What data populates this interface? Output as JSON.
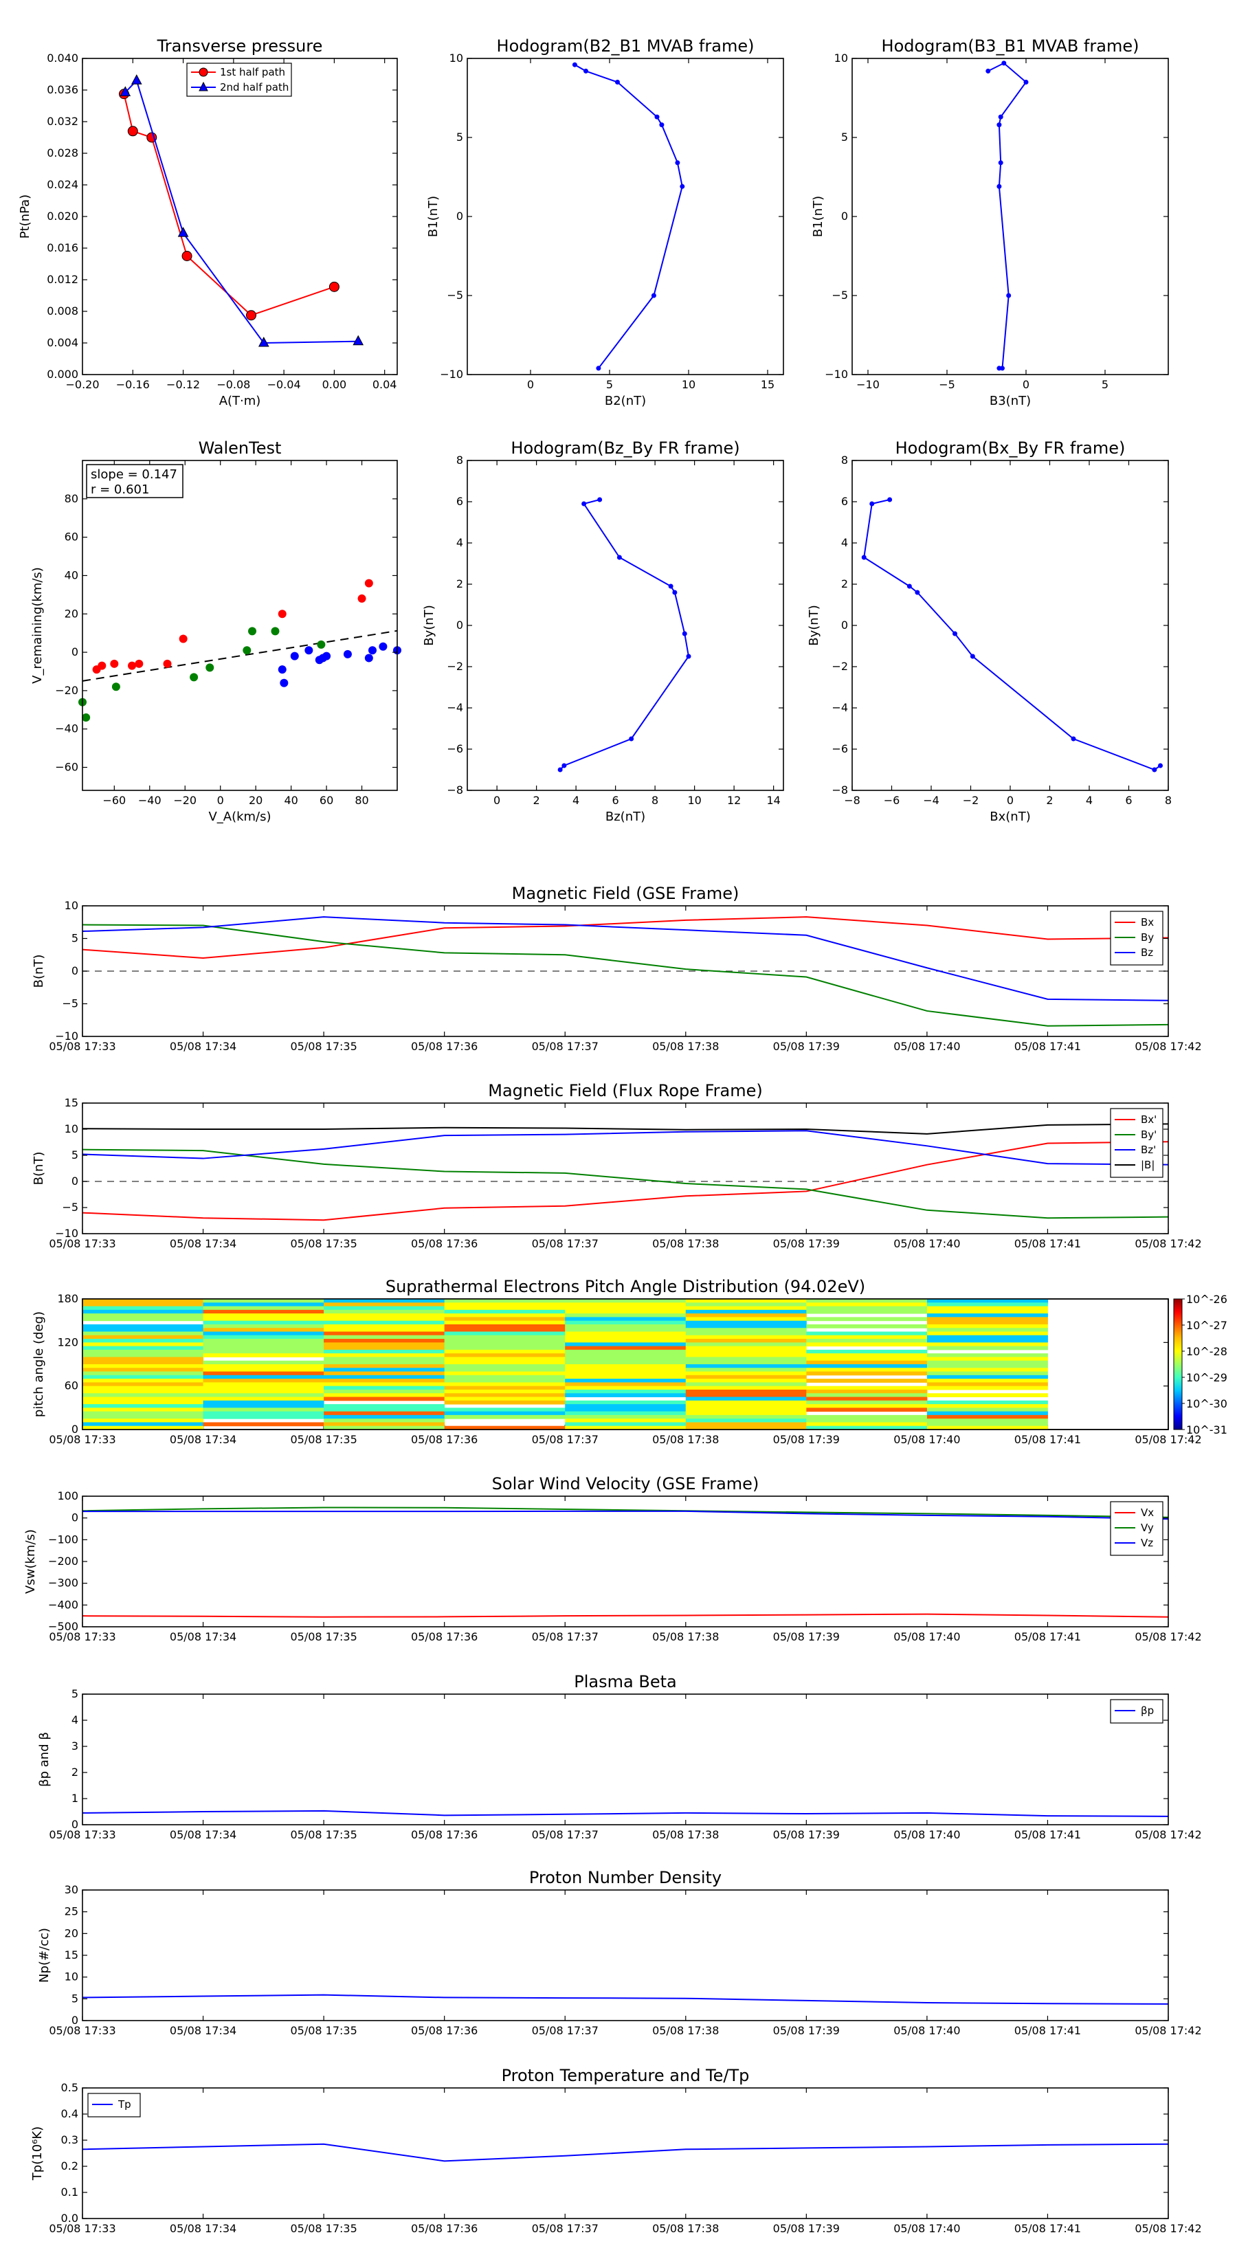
{
  "chart_data": [
    {
      "type": "line",
      "title": "Transverse pressure",
      "xlabel": "A(T·m)",
      "ylabel": "Pt(nPa)",
      "xlim": [
        -0.2,
        0.05
      ],
      "ylim": [
        0.0,
        0.04
      ],
      "xticks": [
        "−0.20",
        "−0.16",
        "−0.12",
        "−0.08",
        "−0.04",
        "0.00",
        "0.04"
      ],
      "yticks": [
        "0.000",
        "0.004",
        "0.008",
        "0.012",
        "0.016",
        "0.020",
        "0.024",
        "0.028",
        "0.032",
        "0.036",
        "0.040"
      ],
      "legend_position": "top-right",
      "series": [
        {
          "name": "1st half path",
          "color": "#ff0000",
          "marker": "circle",
          "x": [
            -0.167,
            -0.16,
            -0.145,
            -0.117,
            -0.066,
            0.0
          ],
          "y": [
            0.0355,
            0.0308,
            0.03,
            0.015,
            0.0075,
            0.0111
          ]
        },
        {
          "name": "2nd half path",
          "color": "#0000ff",
          "marker": "triangle",
          "x": [
            -0.166,
            -0.157,
            -0.12,
            -0.056,
            0.019
          ],
          "y": [
            0.0357,
            0.0372,
            0.0179,
            0.004,
            0.0042
          ]
        }
      ]
    },
    {
      "type": "line",
      "title": "Hodogram(B2_B1 MVAB frame)",
      "xlabel": "B2(nT)",
      "ylabel": "B1(nT)",
      "xlim": [
        -4,
        16
      ],
      "ylim": [
        -10,
        10
      ],
      "xticks": [
        "0",
        "5",
        "10",
        "15"
      ],
      "yticks": [
        "−10",
        "−5",
        "0",
        "5",
        "10"
      ],
      "series": [
        {
          "name": "",
          "color": "#0000ff",
          "x": [
            2.8,
            3.5,
            5.5,
            8.0,
            8.3,
            9.3,
            9.6,
            7.8,
            4.3
          ],
          "y": [
            9.6,
            9.2,
            8.5,
            6.3,
            5.8,
            3.4,
            1.9,
            -5.0,
            -9.6
          ]
        }
      ]
    },
    {
      "type": "line",
      "title": "Hodogram(B3_B1 MVAB frame)",
      "xlabel": "B3(nT)",
      "ylabel": "B1(nT)",
      "xlim": [
        -11,
        9
      ],
      "ylim": [
        -10,
        10
      ],
      "xticks": [
        "−10",
        "−5",
        "0",
        "5"
      ],
      "yticks": [
        "−10",
        "−5",
        "0",
        "5",
        "10"
      ],
      "series": [
        {
          "name": "",
          "color": "#0000ff",
          "x": [
            -2.4,
            -1.4,
            0.0,
            -1.6,
            -1.7,
            -1.6,
            -1.7,
            -1.1,
            -1.5,
            -1.7
          ],
          "y": [
            9.2,
            9.7,
            8.5,
            6.3,
            5.8,
            3.4,
            1.9,
            -5.0,
            -9.6,
            -9.6
          ]
        }
      ]
    },
    {
      "type": "scatter",
      "title": "WalenTest",
      "xlabel": "V_A(km/s)",
      "ylabel": "V_remaining(km/s)",
      "xlim": [
        -78,
        100
      ],
      "ylim": [
        -72,
        100
      ],
      "xticks": [
        "−60",
        "−40",
        "−20",
        "0",
        "20",
        "40",
        "60",
        "80"
      ],
      "yticks": [
        "−60",
        "−40",
        "−20",
        "0",
        "20",
        "40",
        "60",
        "80"
      ],
      "annotations": [
        "slope = 0.147",
        "r = 0.601"
      ],
      "fit_line": {
        "slope": 0.147,
        "intercept": -3.5,
        "style": "dashed"
      },
      "series": [
        {
          "name": "",
          "color": "#ff0000",
          "x": [
            -70,
            -67,
            -60,
            -50,
            -46,
            -30,
            -21,
            35,
            80,
            84
          ],
          "y": [
            -9,
            -7,
            -6,
            -7,
            -6,
            -6,
            7,
            20,
            28,
            36
          ]
        },
        {
          "name": "",
          "color": "#008000",
          "x": [
            -78,
            -76,
            -59,
            -15,
            -6,
            15,
            18,
            31,
            57
          ],
          "y": [
            -26,
            -34,
            -18,
            -13,
            -8,
            1,
            11,
            11,
            4
          ]
        },
        {
          "name": "",
          "color": "#0000ff",
          "x": [
            35,
            36,
            42,
            50,
            56,
            58,
            60,
            72,
            84,
            86,
            92,
            100
          ],
          "y": [
            -9,
            -16,
            -2,
            1,
            -4,
            -3,
            -2,
            -1,
            -3,
            1,
            3,
            1
          ]
        }
      ]
    },
    {
      "type": "line",
      "title": "Hodogram(Bz_By FR frame)",
      "xlabel": "Bz(nT)",
      "ylabel": "By(nT)",
      "xlim": [
        -1.5,
        14.5
      ],
      "ylim": [
        -8,
        8
      ],
      "xticks": [
        "0",
        "2",
        "4",
        "6",
        "8",
        "10",
        "12",
        "14"
      ],
      "yticks": [
        "−8",
        "−6",
        "−4",
        "−2",
        "0",
        "2",
        "4",
        "6",
        "8"
      ],
      "series": [
        {
          "name": "",
          "color": "#0000ff",
          "x": [
            5.2,
            4.4,
            6.2,
            8.8,
            9.0,
            9.5,
            9.7,
            6.8,
            3.4,
            3.2
          ],
          "y": [
            6.1,
            5.9,
            3.3,
            1.9,
            1.6,
            -0.4,
            -1.5,
            -5.5,
            -6.8,
            -7.0
          ]
        }
      ]
    },
    {
      "type": "line",
      "title": "Hodogram(Bx_By FR frame)",
      "xlabel": "Bx(nT)",
      "ylabel": "By(nT)",
      "xlim": [
        -8,
        8
      ],
      "ylim": [
        -8,
        8
      ],
      "xticks": [
        "−8",
        "−6",
        "−4",
        "−2",
        "0",
        "2",
        "4",
        "6",
        "8"
      ],
      "yticks": [
        "−8",
        "−6",
        "−4",
        "−2",
        "0",
        "2",
        "4",
        "6",
        "8"
      ],
      "series": [
        {
          "name": "",
          "color": "#0000ff",
          "x": [
            -6.1,
            -7.0,
            -7.4,
            -5.1,
            -4.7,
            -2.8,
            -1.9,
            3.2,
            7.3,
            7.6
          ],
          "y": [
            6.1,
            5.9,
            3.3,
            1.9,
            1.6,
            -0.4,
            -1.5,
            -5.5,
            -7.0,
            -6.8
          ]
        }
      ]
    },
    {
      "type": "line",
      "title": "Magnetic Field (GSE Frame)",
      "ylabel": "B(nT)",
      "x": [
        "05/08 17:33",
        "05/08 17:34",
        "05/08 17:35",
        "05/08 17:36",
        "05/08 17:37",
        "05/08 17:38",
        "05/08 17:39",
        "05/08 17:40",
        "05/08 17:41",
        "05/08 17:42"
      ],
      "ylim": [
        -10,
        10
      ],
      "yticks": [
        "−10",
        "−5",
        "0",
        "5",
        "10"
      ],
      "zero_line": true,
      "legend_position": "top-right",
      "series": [
        {
          "name": "Bx",
          "color": "#ff0000",
          "values": [
            3.3,
            2.0,
            3.6,
            6.6,
            6.9,
            7.8,
            8.3,
            7.0,
            4.9,
            5.1
          ]
        },
        {
          "name": "By",
          "color": "#008000",
          "values": [
            7.1,
            7.0,
            4.5,
            2.8,
            2.5,
            0.3,
            -0.9,
            -6.1,
            -8.4,
            -8.2
          ]
        },
        {
          "name": "Bz",
          "color": "#0000ff",
          "values": [
            6.1,
            6.7,
            8.3,
            7.4,
            7.1,
            6.3,
            5.5,
            0.5,
            -4.3,
            -4.5
          ]
        }
      ]
    },
    {
      "type": "line",
      "title": "Magnetic Field (Flux Rope Frame)",
      "ylabel": "B(nT)",
      "x": [
        "05/08 17:33",
        "05/08 17:34",
        "05/08 17:35",
        "05/08 17:36",
        "05/08 17:37",
        "05/08 17:38",
        "05/08 17:39",
        "05/08 17:40",
        "05/08 17:41",
        "05/08 17:42"
      ],
      "ylim": [
        -10,
        15
      ],
      "yticks": [
        "−10",
        "−5",
        "0",
        "5",
        "10",
        "15"
      ],
      "zero_line": true,
      "legend_position": "top-right",
      "series": [
        {
          "name": "Bx'",
          "color": "#ff0000",
          "values": [
            -6.0,
            -7.0,
            -7.4,
            -5.1,
            -4.7,
            -2.8,
            -1.9,
            3.2,
            7.3,
            7.6
          ]
        },
        {
          "name": "By'",
          "color": "#008000",
          "values": [
            6.1,
            5.9,
            3.3,
            1.9,
            1.6,
            -0.4,
            -1.5,
            -5.5,
            -7.0,
            -6.8
          ]
        },
        {
          "name": "Bz'",
          "color": "#0000ff",
          "values": [
            5.2,
            4.4,
            6.2,
            8.8,
            9.0,
            9.5,
            9.7,
            6.8,
            3.4,
            3.2
          ]
        },
        {
          "name": "|B|",
          "color": "#000000",
          "values": [
            10.1,
            10.0,
            10.0,
            10.3,
            10.2,
            9.9,
            10.0,
            9.1,
            10.8,
            11.0
          ]
        }
      ]
    },
    {
      "type": "heatmap",
      "title": "Suprathermal Electrons Pitch Angle Distribution (94.02eV)",
      "ylabel": "pitch angle (deg)",
      "x": [
        "05/08 17:33",
        "05/08 17:34",
        "05/08 17:35",
        "05/08 17:36",
        "05/08 17:37",
        "05/08 17:38",
        "05/08 17:39",
        "05/08 17:40",
        "05/08 17:41",
        "05/08 17:42"
      ],
      "ylim": [
        0,
        180
      ],
      "yticks": [
        "0",
        "60",
        "120",
        "180"
      ],
      "colorbar_ticks": [
        "10^-31",
        "10^-30",
        "10^-29",
        "10^-28",
        "10^-27",
        "10^-26"
      ],
      "colorbar_log_range": [
        -31,
        -26
      ],
      "columns_with_data": 8
    },
    {
      "type": "line",
      "title": "Solar Wind Velocity (GSE Frame)",
      "ylabel": "Vsw(km/s)",
      "x": [
        "05/08 17:33",
        "05/08 17:34",
        "05/08 17:35",
        "05/08 17:36",
        "05/08 17:37",
        "05/08 17:38",
        "05/08 17:39",
        "05/08 17:40",
        "05/08 17:41",
        "05/08 17:42"
      ],
      "ylim": [
        -500,
        100
      ],
      "yticks": [
        "−500",
        "−400",
        "−300",
        "−200",
        "−100",
        "0",
        "100"
      ],
      "legend_position": "top-right",
      "series": [
        {
          "name": "Vx",
          "color": "#ff0000",
          "values": [
            -450,
            -452,
            -455,
            -454,
            -450,
            -448,
            -445,
            -442,
            -448,
            -455
          ]
        },
        {
          "name": "Vy",
          "color": "#008000",
          "values": [
            33,
            42,
            48,
            47,
            40,
            33,
            26,
            20,
            12,
            3
          ]
        },
        {
          "name": "Vz",
          "color": "#0000ff",
          "values": [
            30,
            30,
            30,
            30,
            31,
            31,
            20,
            12,
            6,
            -5
          ]
        }
      ]
    },
    {
      "type": "line",
      "title": "Plasma Beta",
      "ylabel": "βp and β",
      "x": [
        "05/08 17:33",
        "05/08 17:34",
        "05/08 17:35",
        "05/08 17:36",
        "05/08 17:37",
        "05/08 17:38",
        "05/08 17:39",
        "05/08 17:40",
        "05/08 17:41",
        "05/08 17:42"
      ],
      "ylim": [
        0,
        5
      ],
      "yticks": [
        "0",
        "1",
        "2",
        "3",
        "4",
        "5"
      ],
      "legend_position": "top-right",
      "series": [
        {
          "name": "βp",
          "color": "#0000ff",
          "values": [
            0.45,
            0.5,
            0.53,
            0.36,
            0.4,
            0.45,
            0.42,
            0.45,
            0.34,
            0.32
          ]
        }
      ]
    },
    {
      "type": "line",
      "title": "Proton Number Density",
      "ylabel": "Np(#/cc)",
      "x": [
        "05/08 17:33",
        "05/08 17:34",
        "05/08 17:35",
        "05/08 17:36",
        "05/08 17:37",
        "05/08 17:38",
        "05/08 17:39",
        "05/08 17:40",
        "05/08 17:41",
        "05/08 17:42"
      ],
      "ylim": [
        0,
        30
      ],
      "yticks": [
        "0",
        "5",
        "10",
        "15",
        "20",
        "25",
        "30"
      ],
      "series": [
        {
          "name": "",
          "color": "#0000ff",
          "values": [
            5.3,
            5.6,
            5.9,
            5.3,
            5.2,
            5.1,
            4.6,
            4.1,
            3.9,
            3.8
          ]
        }
      ]
    },
    {
      "type": "line",
      "title": "Proton Temperature and Te/Tp",
      "ylabel": "Tp(10⁶K)",
      "x": [
        "05/08 17:33",
        "05/08 17:34",
        "05/08 17:35",
        "05/08 17:36",
        "05/08 17:37",
        "05/08 17:38",
        "05/08 17:39",
        "05/08 17:40",
        "05/08 17:41",
        "05/08 17:42"
      ],
      "ylim": [
        0,
        0.5
      ],
      "yticks": [
        "0.0",
        "0.1",
        "0.2",
        "0.3",
        "0.4",
        "0.5"
      ],
      "legend_position": "top-left",
      "series": [
        {
          "name": "Tp",
          "color": "#0000ff",
          "values": [
            0.265,
            0.275,
            0.285,
            0.22,
            0.24,
            0.265,
            0.27,
            0.275,
            0.282,
            0.285
          ]
        }
      ]
    }
  ]
}
